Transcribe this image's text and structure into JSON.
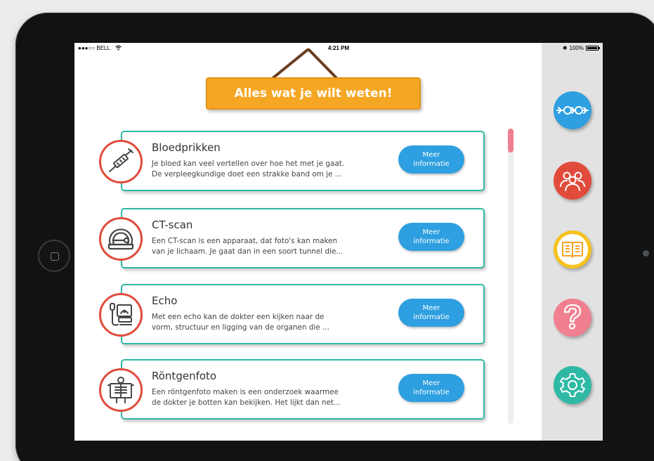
{
  "status_bar": {
    "carrier": "●●●○○ BELL",
    "time": "4:21 PM",
    "battery": "100%"
  },
  "banner": {
    "title": "Alles wat je wilt weten!"
  },
  "items": [
    {
      "title": "Bloedprikken",
      "line1": "Je bloed kan veel vertellen over hoe het met je gaat.",
      "line2": "De verpleegkundige doet een strakke band om je ...",
      "button_line1": "Meer",
      "button_line2": "informatie",
      "icon": "syringe-icon"
    },
    {
      "title": "CT-scan",
      "line1": "Een CT-scan is een apparaat, dat foto's kan maken",
      "line2": "van je lichaam. Je gaat dan in een soort tunnel die...",
      "button_line1": "Meer",
      "button_line2": "informatie",
      "icon": "ct-scanner-icon"
    },
    {
      "title": "Echo",
      "line1": "Met een echo kan de dokter een kijken naar de",
      "line2": "vorm, structuur en ligging van de organen die ...",
      "button_line1": "Meer",
      "button_line2": "informatie",
      "icon": "ultrasound-icon"
    },
    {
      "title": "Röntgenfoto",
      "line1": "Een röntgenfoto maken is een onderzoek waarmee",
      "line2": "de dokter je botten kan bekijken. Het lijkt dan net...",
      "button_line1": "Meer",
      "button_line2": "informatie",
      "icon": "xray-icon"
    }
  ],
  "sidebar": [
    {
      "name": "timeline-icon",
      "color": "#2e9fe0"
    },
    {
      "name": "group-icon",
      "color": "#e14b3b"
    },
    {
      "name": "book-icon",
      "color": "#f7c21c"
    },
    {
      "name": "question-icon",
      "color": "#f07f90"
    },
    {
      "name": "settings-icon",
      "color": "#2fb9a4"
    }
  ],
  "colors": {
    "card_border": "#2fb9a4",
    "icon_ring": "#e14b3b",
    "button": "#2e9fe0",
    "banner": "#f5a623"
  }
}
